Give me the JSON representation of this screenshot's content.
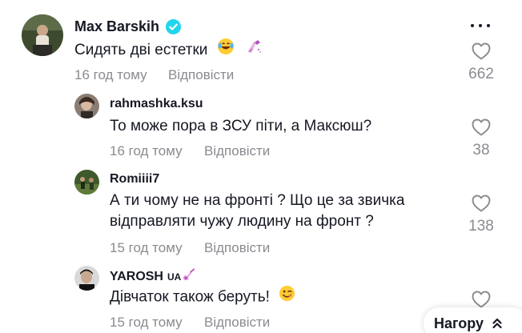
{
  "main_comment": {
    "author": "Max Barskih",
    "text": "Сидять дві естетки",
    "time": "16 год тому",
    "reply_label": "Відповісти",
    "likes": "662"
  },
  "replies": [
    {
      "author": "rahmashka.ksu",
      "text_lines": [
        "То може пора в ЗСУ піти, а Максюш?"
      ],
      "time": "16 год тому",
      "reply_label": "Відповісти",
      "likes": "38"
    },
    {
      "author": "Romiiii7",
      "text_lines": [
        "А ти чому не на фронті ? Що це за звичка",
        "відправляти чужу людину на фронт ?"
      ],
      "time": "15 год тому",
      "reply_label": "Відповісти",
      "likes": "138"
    },
    {
      "author": "YAROSH",
      "author_suffix": "UA",
      "text_lines": [
        "Дівчаток також беруть!"
      ],
      "time": "15 год тому",
      "reply_label": "Відповісти"
    }
  ],
  "scroll_top_button": {
    "label": "Нагору"
  },
  "icons": {
    "verified": "verified-badge-icon",
    "like": "heart-outline-icon",
    "more": "more-horizontal-icon",
    "top": "double-chevron-up-icon"
  },
  "colors": {
    "verified": "#20d5ec",
    "meta_text": "#8a8b91",
    "primary_text": "#161823"
  }
}
